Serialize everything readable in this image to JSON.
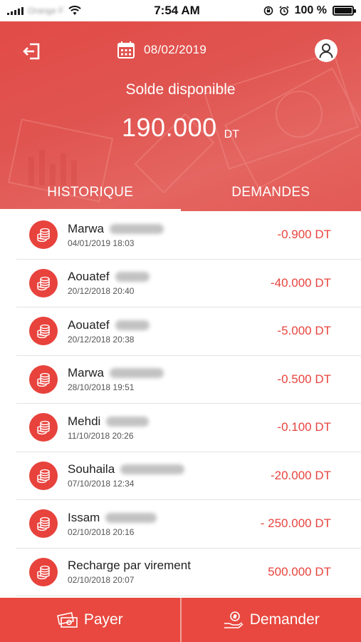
{
  "status_bar": {
    "carrier": "Orange F",
    "time": "7:54 AM",
    "battery": "100 %"
  },
  "header": {
    "date": "08/02/2019",
    "balance_label": "Solde disponible",
    "balance_amount": "190.000",
    "balance_unit": "DT",
    "tabs": [
      {
        "label": "HISTORIQUE",
        "active": true
      },
      {
        "label": "DEMANDES",
        "active": false
      }
    ]
  },
  "transactions": [
    {
      "name": "Marwa",
      "datetime": "04/01/2019 18:03",
      "amount": "-0.900 DT"
    },
    {
      "name": "Aouatef",
      "datetime": "20/12/2018 20:40",
      "amount": "-40.000 DT"
    },
    {
      "name": "Aouatef",
      "datetime": "20/12/2018 20:38",
      "amount": "-5.000 DT"
    },
    {
      "name": "Marwa",
      "datetime": "28/10/2018 19:51",
      "amount": "-0.500 DT"
    },
    {
      "name": "Mehdi",
      "datetime": "11/10/2018 20:26",
      "amount": "-0.100 DT"
    },
    {
      "name": "Souhaila",
      "datetime": "07/10/2018 12:34",
      "amount": "-20.000 DT"
    },
    {
      "name": "Issam",
      "datetime": "02/10/2018 20:16",
      "amount": "- 250.000 DT"
    },
    {
      "name": "Recharge par virement",
      "datetime": "02/10/2018 20:07",
      "amount": "500.000 DT"
    }
  ],
  "bottom_bar": {
    "pay_label": "Payer",
    "request_label": "Demander"
  },
  "colors": {
    "primary": "#e8443e",
    "header": "#e24b47",
    "text": "#222222"
  }
}
